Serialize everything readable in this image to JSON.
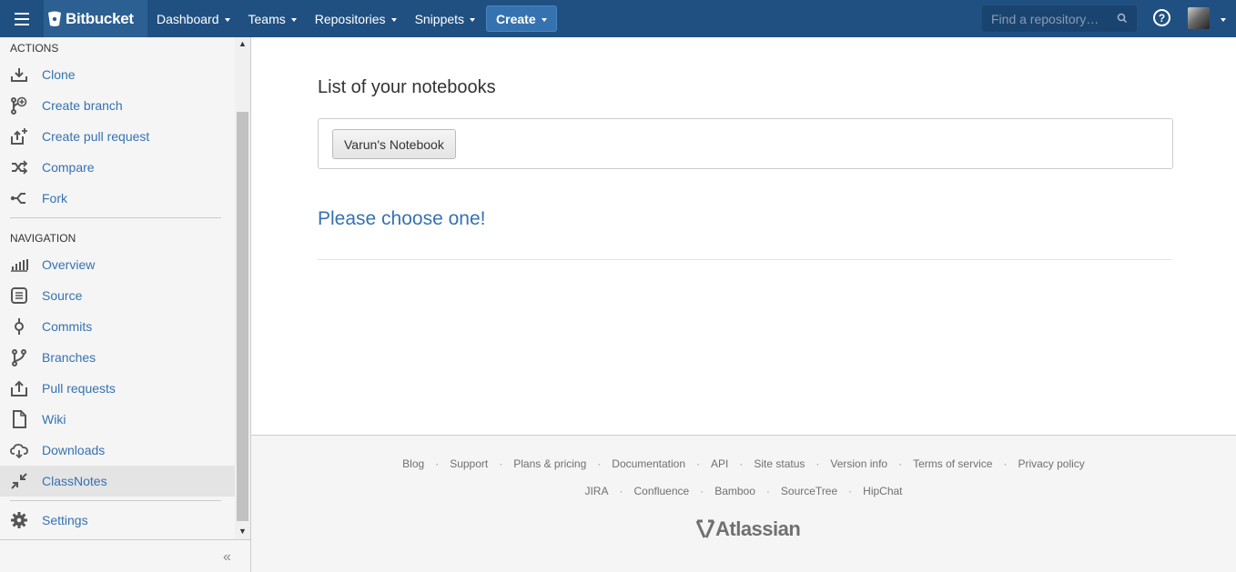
{
  "topbar": {
    "brand": "Bitbucket",
    "nav": [
      {
        "label": "Dashboard"
      },
      {
        "label": "Teams"
      },
      {
        "label": "Repositories"
      },
      {
        "label": "Snippets"
      }
    ],
    "create_label": "Create",
    "search_placeholder": "Find a repository…",
    "help_glyph": "?"
  },
  "sidebar": {
    "actions_heading": "ACTIONS",
    "actions": [
      {
        "label": "Clone",
        "icon": "download-icon"
      },
      {
        "label": "Create branch",
        "icon": "branch-add-icon"
      },
      {
        "label": "Create pull request",
        "icon": "pull-request-add-icon"
      },
      {
        "label": "Compare",
        "icon": "shuffle-icon"
      },
      {
        "label": "Fork",
        "icon": "fork-icon"
      }
    ],
    "navigation_heading": "NAVIGATION",
    "navigation": [
      {
        "label": "Overview",
        "icon": "bar-chart-icon"
      },
      {
        "label": "Source",
        "icon": "file-text-icon"
      },
      {
        "label": "Commits",
        "icon": "commit-icon"
      },
      {
        "label": "Branches",
        "icon": "branch-icon"
      },
      {
        "label": "Pull requests",
        "icon": "pull-request-icon"
      },
      {
        "label": "Wiki",
        "icon": "page-icon"
      },
      {
        "label": "Downloads",
        "icon": "cloud-download-icon"
      },
      {
        "label": "ClassNotes",
        "icon": "collapse-arrows-icon"
      }
    ],
    "settings_label": "Settings",
    "collapse_glyph": "«"
  },
  "main": {
    "title": "List of your notebooks",
    "notebook_button": "Varun's Notebook",
    "prompt": "Please choose one!"
  },
  "footer": {
    "row1": [
      "Blog",
      "Support",
      "Plans & pricing",
      "Documentation",
      "API",
      "Site status",
      "Version info",
      "Terms of service",
      "Privacy policy"
    ],
    "row2": [
      "JIRA",
      "Confluence",
      "Bamboo",
      "SourceTree",
      "HipChat"
    ],
    "brand": "Atlassian"
  },
  "colors": {
    "topbar": "#205081",
    "link": "#3572b0"
  }
}
